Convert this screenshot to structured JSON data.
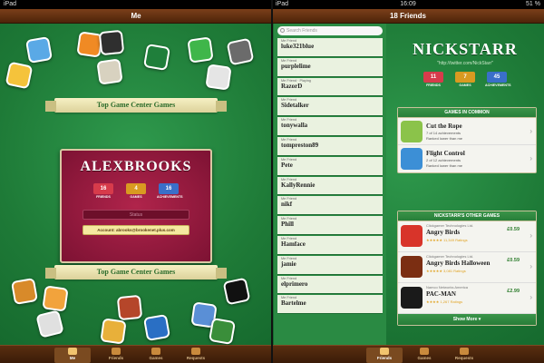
{
  "status_bar": {
    "carrier": "iPad",
    "time": "16:09",
    "battery": "51 %"
  },
  "left": {
    "title": "Me",
    "ribbon_top": "Top Game Center Games",
    "ribbon_bottom": "Top Game Center Games",
    "profile": {
      "name": "ALEXBROOKS",
      "stats": [
        {
          "value": "16",
          "label": "FRIENDS",
          "color": "#d73b4b"
        },
        {
          "value": "4",
          "label": "GAMES",
          "color": "#d99a21"
        },
        {
          "value": "16",
          "label": "ACHIEVEMENTS",
          "color": "#3a6fc9"
        }
      ],
      "status_placeholder": "Status",
      "account": "Account: abrooks@brookenet.plus.com"
    },
    "tabs": [
      {
        "label": "Me",
        "active": true
      },
      {
        "label": "Friends",
        "active": false
      },
      {
        "label": "Games",
        "active": false
      },
      {
        "label": "Requests",
        "active": false
      }
    ]
  },
  "right": {
    "title": "18 Friends",
    "search_placeholder": "Search Friends",
    "friends": [
      {
        "name": "luke321blue",
        "sub": "Me Friend"
      },
      {
        "name": "purplelime",
        "sub": "Me Friend"
      },
      {
        "name": "RazorD",
        "sub": "Me Friend · Playing"
      },
      {
        "name": "Sidetalker",
        "sub": "Me Friend"
      },
      {
        "name": "tonywalla",
        "sub": "Me Friend"
      },
      {
        "name": "tompreston89",
        "sub": "Me Friend"
      },
      {
        "name": "Pete",
        "sub": "Me Friend"
      },
      {
        "name": "KallyRennie",
        "sub": "Me Friend"
      },
      {
        "name": "nikf",
        "sub": "Me Friend"
      },
      {
        "name": "Phill",
        "sub": "Me Friend"
      },
      {
        "name": "Hamface",
        "sub": "Me Friend"
      },
      {
        "name": "jamie",
        "sub": "Me Friend"
      },
      {
        "name": "elprimero",
        "sub": "Me Friend"
      },
      {
        "name": "Bartelme",
        "sub": "Me Friend"
      }
    ],
    "profile": {
      "name": "NICKSTARR",
      "twitter": "\"http://twitter.com/NickStarr\"",
      "stats": [
        {
          "value": "11",
          "label": "FRIENDS",
          "color": "#d73b4b"
        },
        {
          "value": "7",
          "label": "GAMES",
          "color": "#d99a21"
        },
        {
          "value": "45",
          "label": "ACHIEVEMENTS",
          "color": "#3a6fc9"
        }
      ]
    },
    "games_in_common": {
      "title": "GAMES IN COMMON",
      "items": [
        {
          "name": "Cut the Rope",
          "line1": "7 of 14 achievements",
          "line2": "Ranked lower than me",
          "icon_color": "#8bc34a"
        },
        {
          "name": "Flight Control",
          "line1": "2 of 12 achievements",
          "line2": "Ranked lower than me",
          "icon_color": "#3c8fd6"
        }
      ]
    },
    "other_games": {
      "title": "NICKSTARR'S OTHER GAMES",
      "items": [
        {
          "publisher": "Clickgamer Technologies Ltd.",
          "name": "Angry Birds",
          "rating": "★★★★★ 11,349 Ratings",
          "price": "£0.59",
          "icon_color": "#d8342a"
        },
        {
          "publisher": "Clickgamer Technologies Ltd.",
          "name": "Angry Birds Halloween",
          "rating": "★★★★★ 3,081 Ratings",
          "price": "£0.59",
          "icon_color": "#7b2e12"
        },
        {
          "publisher": "Namco Networks America",
          "name": "PAC-MAN",
          "rating": "★★★★ 1,267 Ratings",
          "price": "£2.99",
          "icon_color": "#1a1a1a"
        }
      ],
      "show_more": "Show More ▾"
    },
    "tabs": [
      {
        "label": "Friends",
        "active": true
      },
      {
        "label": "Games",
        "active": false
      },
      {
        "label": "Requests",
        "active": false
      }
    ]
  }
}
